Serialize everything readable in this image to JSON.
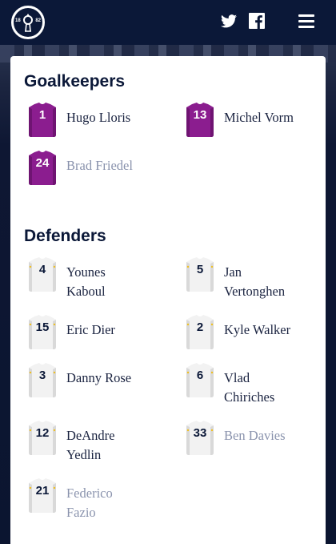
{
  "header": {
    "crest_year_left": "18",
    "crest_year_right": "82",
    "icons": [
      "twitter-icon",
      "facebook-icon",
      "menu-icon"
    ]
  },
  "colors": {
    "navy": "#0b1838",
    "goalkeeper_kit": "#8b1d8f",
    "outfield_kit": "#f2f2f2",
    "inactive_text": "#8a93ad"
  },
  "squad": {
    "goalkeepers": {
      "title": "Goalkeepers",
      "players": [
        {
          "number": "1",
          "name": "Hugo Lloris",
          "active": true
        },
        {
          "number": "13",
          "name": "Michel Vorm",
          "active": true
        },
        {
          "number": "24",
          "name": "Brad Friedel",
          "active": false
        }
      ]
    },
    "defenders": {
      "title": "Defenders",
      "players": [
        {
          "number": "4",
          "name": "Younes Kaboul",
          "active": true
        },
        {
          "number": "5",
          "name": "Jan Vertonghen",
          "active": true
        },
        {
          "number": "15",
          "name": "Eric Dier",
          "active": true
        },
        {
          "number": "2",
          "name": "Kyle Walker",
          "active": true
        },
        {
          "number": "3",
          "name": "Danny Rose",
          "active": true
        },
        {
          "number": "6",
          "name": "Vlad Chiriches",
          "active": true
        },
        {
          "number": "12",
          "name": "DeAndre Yedlin",
          "active": true
        },
        {
          "number": "33",
          "name": "Ben Davies",
          "active": false
        },
        {
          "number": "21",
          "name": "Federico Fazio",
          "active": false
        }
      ]
    }
  }
}
